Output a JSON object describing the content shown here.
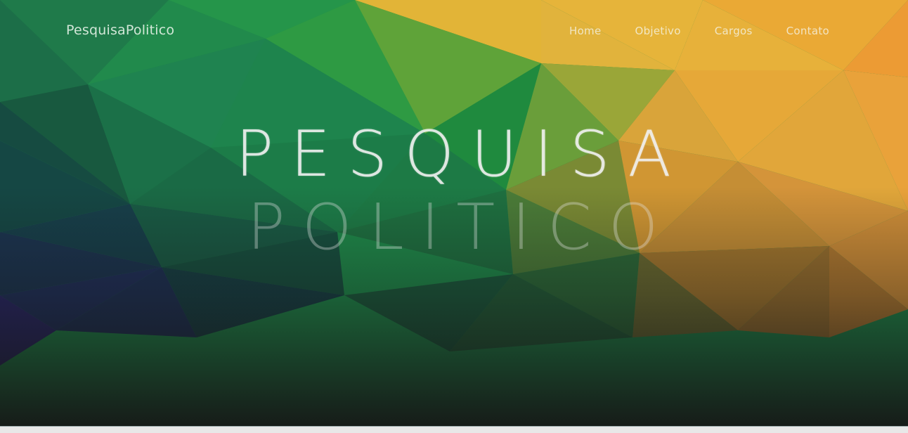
{
  "brand": "PesquisaPolitico",
  "nav": {
    "home": "Home",
    "objetivo": "Objetivo",
    "cargos": "Cargos",
    "contato": "Contato"
  },
  "hero": {
    "title_line1": "PESQUISA",
    "title_line2": "POLITICO"
  },
  "colors": {
    "green": "#1f8f4a",
    "yellow": "#e8b43a",
    "orange": "#ec9a32",
    "blue": "#1c3f6a",
    "dark": "#1a1a1a"
  }
}
